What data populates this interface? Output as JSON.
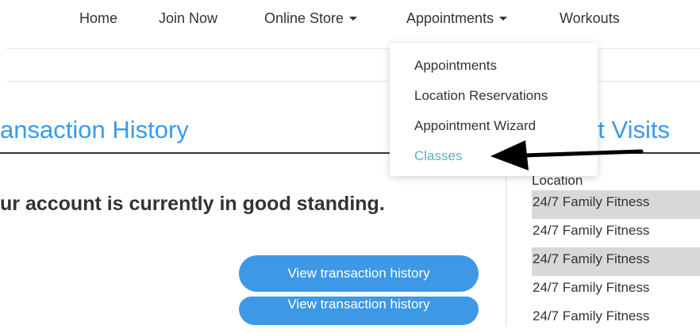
{
  "nav": {
    "items": [
      {
        "label": "Home",
        "dropdown": false
      },
      {
        "label": "Join Now",
        "dropdown": false
      },
      {
        "label": "Online Store",
        "dropdown": true
      },
      {
        "label": "Appointments",
        "dropdown": true
      },
      {
        "label": "Workouts",
        "dropdown": false
      }
    ]
  },
  "dropdown": {
    "items": [
      {
        "label": "Appointments"
      },
      {
        "label": "Location Reservations"
      },
      {
        "label": "Appointment Wizard"
      },
      {
        "label": "Classes",
        "highlighted": true
      }
    ]
  },
  "left_panel": {
    "title": "ansaction History",
    "status_text": "ur account is currently in good standing.",
    "buttons": [
      {
        "label": "View transaction history"
      },
      {
        "label": "View transaction history"
      }
    ]
  },
  "right_panel": {
    "title": "nt Visits",
    "table": {
      "header": "Location",
      "rows": [
        {
          "location": "24/7 Family Fitness",
          "shaded": true
        },
        {
          "location": "24/7 Family Fitness",
          "shaded": false
        },
        {
          "location": "24/7 Family Fitness",
          "shaded": true
        },
        {
          "location": "24/7 Family Fitness",
          "shaded": false
        },
        {
          "location": "24/7 Family Fitness",
          "shaded": false
        }
      ]
    }
  },
  "colors": {
    "accent": "#3b9ae8",
    "button": "#3d98e6",
    "highlighted_item": "#5fb0b8",
    "row_shade": "#d8d8d8"
  },
  "annotation_icon": "arrow-left-icon"
}
